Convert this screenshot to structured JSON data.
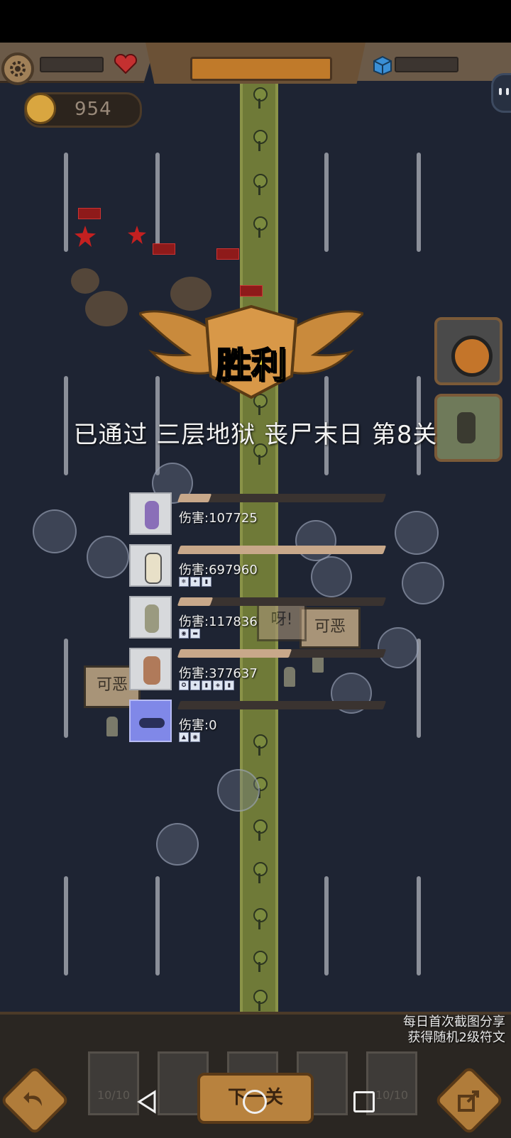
{
  "hud": {
    "coins": "954"
  },
  "victory": {
    "title": "胜利",
    "cleared_message": "已通过 三层地狱 丧尸末日 第8关"
  },
  "damage_report": [
    {
      "label": "伤害:107725",
      "fill_fraction": 0.15,
      "runes": []
    },
    {
      "label": "伤害:697960",
      "fill_fraction": 1.0,
      "runes": [
        "❄",
        "✦",
        "▮"
      ]
    },
    {
      "label": "伤害:117836",
      "fill_fraction": 0.16,
      "runes": [
        "◉",
        "▬"
      ]
    },
    {
      "label": "伤害:377637",
      "fill_fraction": 0.54,
      "runes": [
        "✪",
        "✦",
        "▮",
        "◈",
        "▮"
      ]
    },
    {
      "label": "伤害:0",
      "fill_fraction": 0.0,
      "runes": [
        "▲",
        "◉"
      ]
    }
  ],
  "signs": {
    "left": "可恶",
    "right": "可恶",
    "middle": "呀!"
  },
  "bottom": {
    "share_line1": "每日首次截图分享",
    "share_line2": "获得随机2级符文",
    "next_button": "下一关",
    "card_counts": [
      "10/10",
      "",
      "",
      "",
      "10/10"
    ]
  },
  "colors": {
    "background": "#1e2433",
    "victory_text": "#ffe93a",
    "road": "#6f7a38",
    "wing": "#c98a3c"
  },
  "icons": [
    "gear-icon",
    "heart-icon",
    "coin-icon",
    "cube-icon",
    "bot-icon",
    "back-icon",
    "share-icon"
  ]
}
